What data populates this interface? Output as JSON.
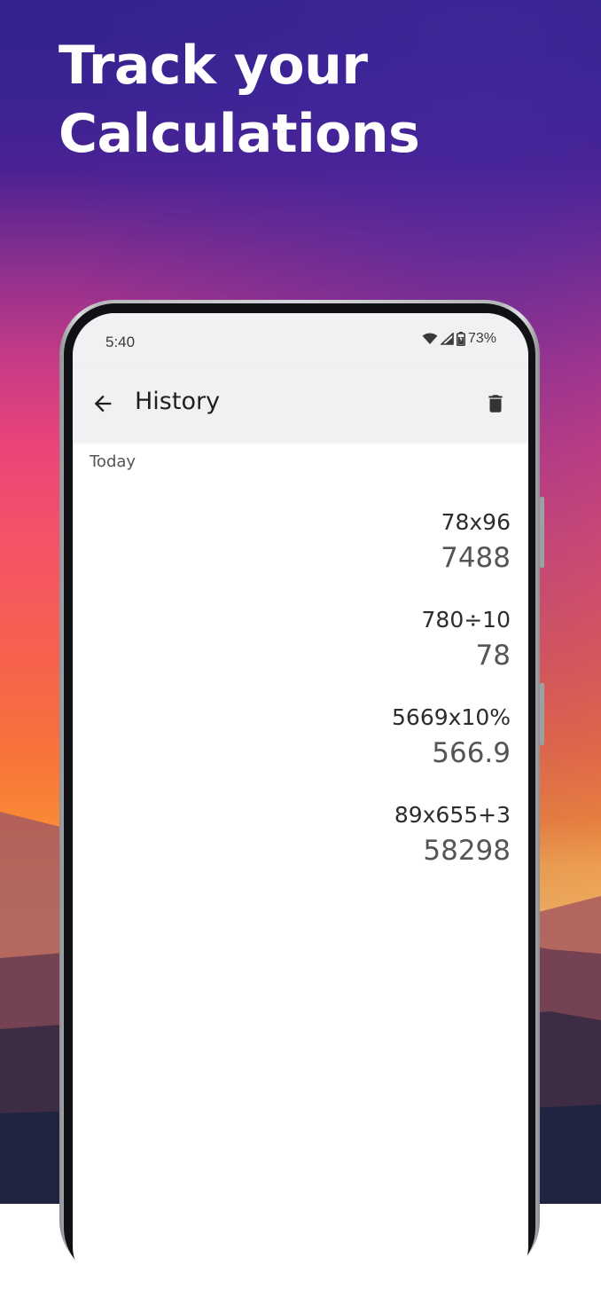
{
  "promo": {
    "title_line1": "Track your",
    "title_line2": "Calculations"
  },
  "status_bar": {
    "time": "5:40",
    "battery": "73%",
    "icons": [
      "wifi-icon",
      "cellular-signal-icon",
      "battery-icon"
    ]
  },
  "app_bar": {
    "title": "History",
    "back_icon": "arrow-left-icon",
    "delete_icon": "trash-icon"
  },
  "history": {
    "section": "Today",
    "items": [
      {
        "expression": "78x96",
        "result": "7488"
      },
      {
        "expression": "780÷10",
        "result": "78"
      },
      {
        "expression": "5669x10%",
        "result": "566.9"
      },
      {
        "expression": "89x655+3",
        "result": "58298"
      }
    ]
  },
  "colors": {
    "status_bar_bg": "#f0f1f3",
    "screen_bg": "#ffffff",
    "text_primary": "#2c2c2c",
    "text_secondary": "#555555"
  }
}
